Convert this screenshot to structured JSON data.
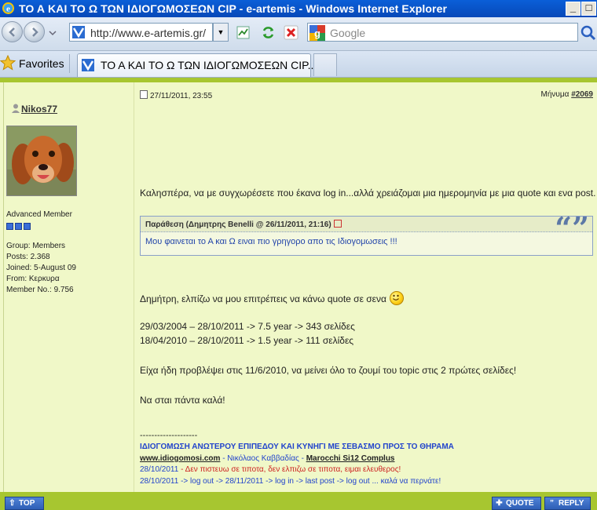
{
  "window": {
    "title": "ΤΟ Α ΚΑΙ ΤΟ Ω ΤΩΝ ΙΔΙΟΓΩΜΟΣΕΩΝ CIP - e-artemis - Windows Internet Explorer",
    "minimize": "_",
    "maximize": "□"
  },
  "nav": {
    "url": "http://www.e-artemis.gr/",
    "search_placeholder": "Google"
  },
  "tabs": {
    "favorites_label": "Favorites",
    "active_tab_label": "ΤΟ Α ΚΑΙ ΤΟ Ω ΤΩΝ ΙΔΙΟΓΩΜΟΣΕΩΝ CIP..."
  },
  "post": {
    "date": "27/11/2011, 23:55",
    "message_label": "Μήνυμα",
    "message_number": "#2069",
    "author": {
      "username": "Nikos77",
      "rank": "Advanced Member",
      "rank_pips": 3,
      "group": "Group: Members",
      "posts": "Posts: 2.368",
      "joined": "Joined: 5-August 09",
      "from": "From: Κερκυρα",
      "member_no": "Member No.: 9.756"
    },
    "intro": "Καλησπέρα, να με συγχωρέσετε που έκανα log in...αλλά χρειάζομαι μια ημερομηνία με μια quote και ενα post.",
    "quote": {
      "header": "Παράθεση (Δημητρης Benelli @ 26/11/2011, 21:16)",
      "marks": "“”",
      "text": "Μου φαινεται το Α και Ω ειναι πιο γρηγορο απο τις Ιδιογομωσεις !!!"
    },
    "line1": "Δημήτρη, ελπίζω να μου επιτρέπεις να κάνω quote σε σενα",
    "line2": "29/03/2004 – 28/10/2011 -> 7.5 year -> 343 σελίδες",
    "line3": "18/04/2010 – 28/10/2011 -> 1.5 year -> 111 σελίδες",
    "line4": "Είχα ήδη προβλέψει στις 11/6/2010, να μείνει όλο το ζουμί του topic στις 2 πρώτες σελίδες!",
    "line5": "Να σται πάντα καλά!",
    "signature": {
      "divider": "--------------------",
      "motto": "ΙΔΙΟΓΟΜΩΣΗ ΑΝΩΤΕΡΟΥ ΕΠΙΠΕΔΟΥ ΚΑΙ ΚΥΝΗΓΙ ΜΕ ΣΕΒΑΣΜΟ ΠΡΟΣ ΤΟ ΘΗΡΑΜΑ",
      "site": "www.idiogomosi.com",
      "site_sep": " - Νικόλαος Καββαδίας - ",
      "gun": "Marocchi Si12 Complus",
      "red_date": "28/10/2011",
      "red_text": " - Δεν πιστευω σε τιποτα, δεν ελπιζω σε τιποτα, ειμαι ελευθερος!",
      "blue_line": "28/10/2011 -> log out -> 28/11/2011 -> log in -> last post -> log out ... καλά να περνάτε!"
    }
  },
  "buttons": {
    "top": "TOP",
    "quote": "QUOTE",
    "reply": "REPLY"
  },
  "colors": {
    "accent_green": "#a7c630",
    "post_bg": "#f0f8c8",
    "sig_blue": "#2244cc",
    "sig_red": "#cc2222"
  }
}
